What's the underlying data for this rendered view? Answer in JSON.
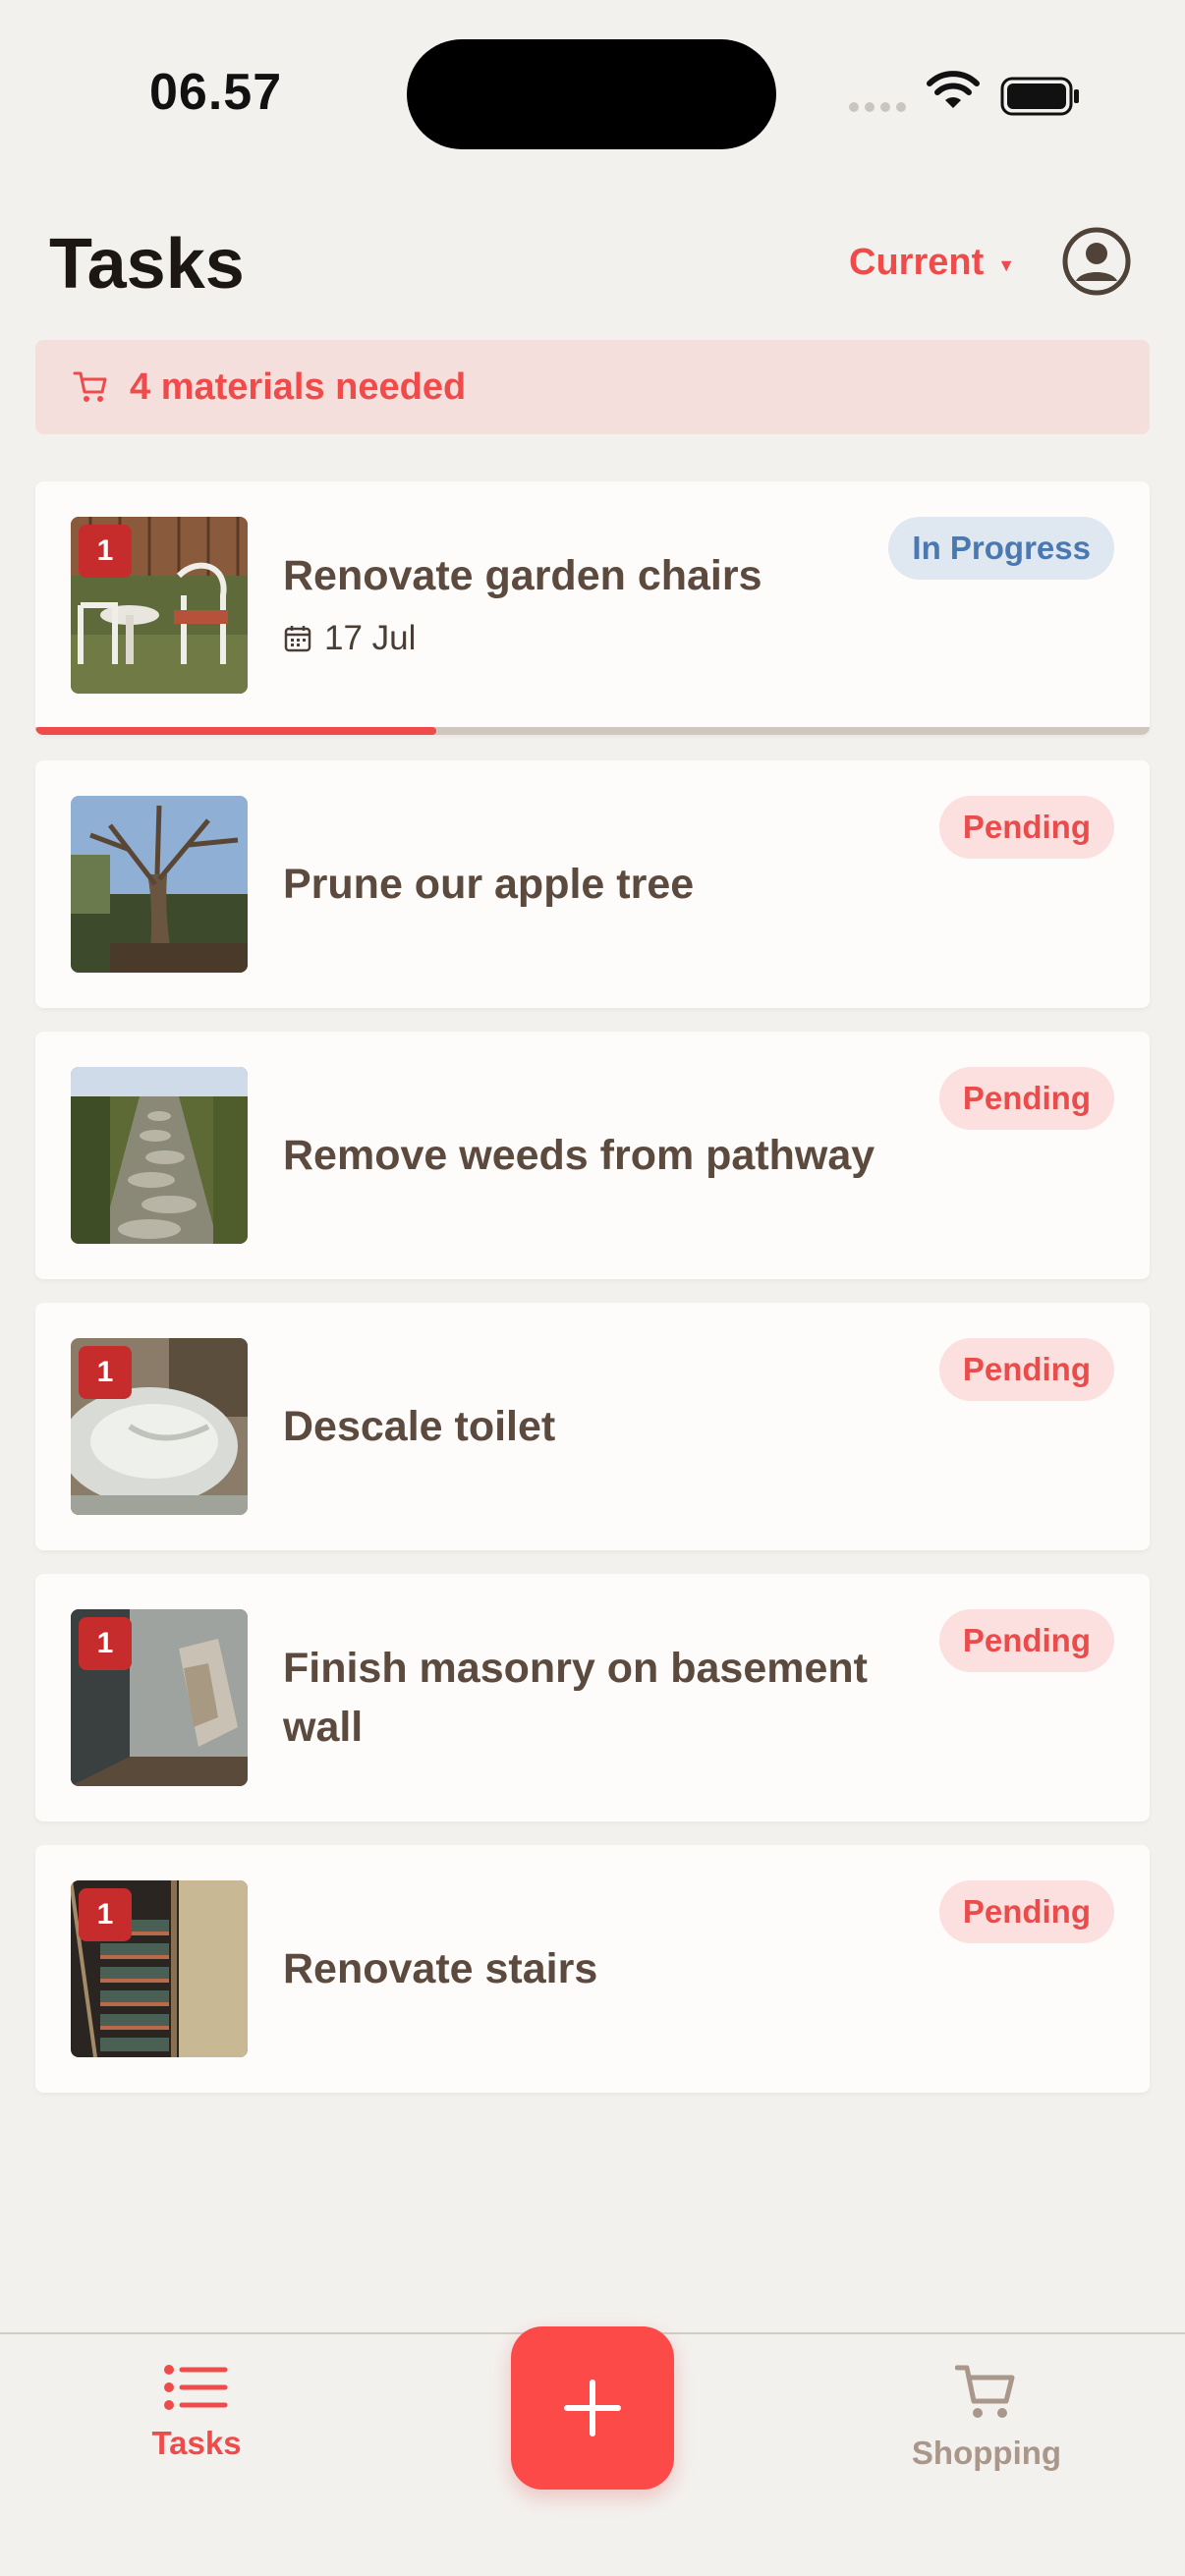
{
  "status_bar": {
    "time": "06.57"
  },
  "header": {
    "title": "Tasks",
    "filter_label": "Current"
  },
  "banner": {
    "text": "4 materials needed"
  },
  "tasks": [
    {
      "title": "Renovate garden chairs",
      "status": "In Progress",
      "badge": "1",
      "due": "17 Jul",
      "progress": 0.36
    },
    {
      "title": "Prune our apple tree",
      "status": "Pending"
    },
    {
      "title": "Remove weeds from pathway",
      "status": "Pending"
    },
    {
      "title": "Descale toilet",
      "status": "Pending",
      "badge": "1"
    },
    {
      "title": "Finish masonry on basement wall",
      "status": "Pending",
      "badge": "1"
    },
    {
      "title": "Renovate stairs",
      "status": "Pending",
      "badge": "1"
    }
  ],
  "tabbar": {
    "tasks_label": "Tasks",
    "shopping_label": "Shopping"
  },
  "colors": {
    "accent": "#ef4b4b",
    "in_progress": "#4a78b0",
    "pending": "#ea4c4c"
  }
}
